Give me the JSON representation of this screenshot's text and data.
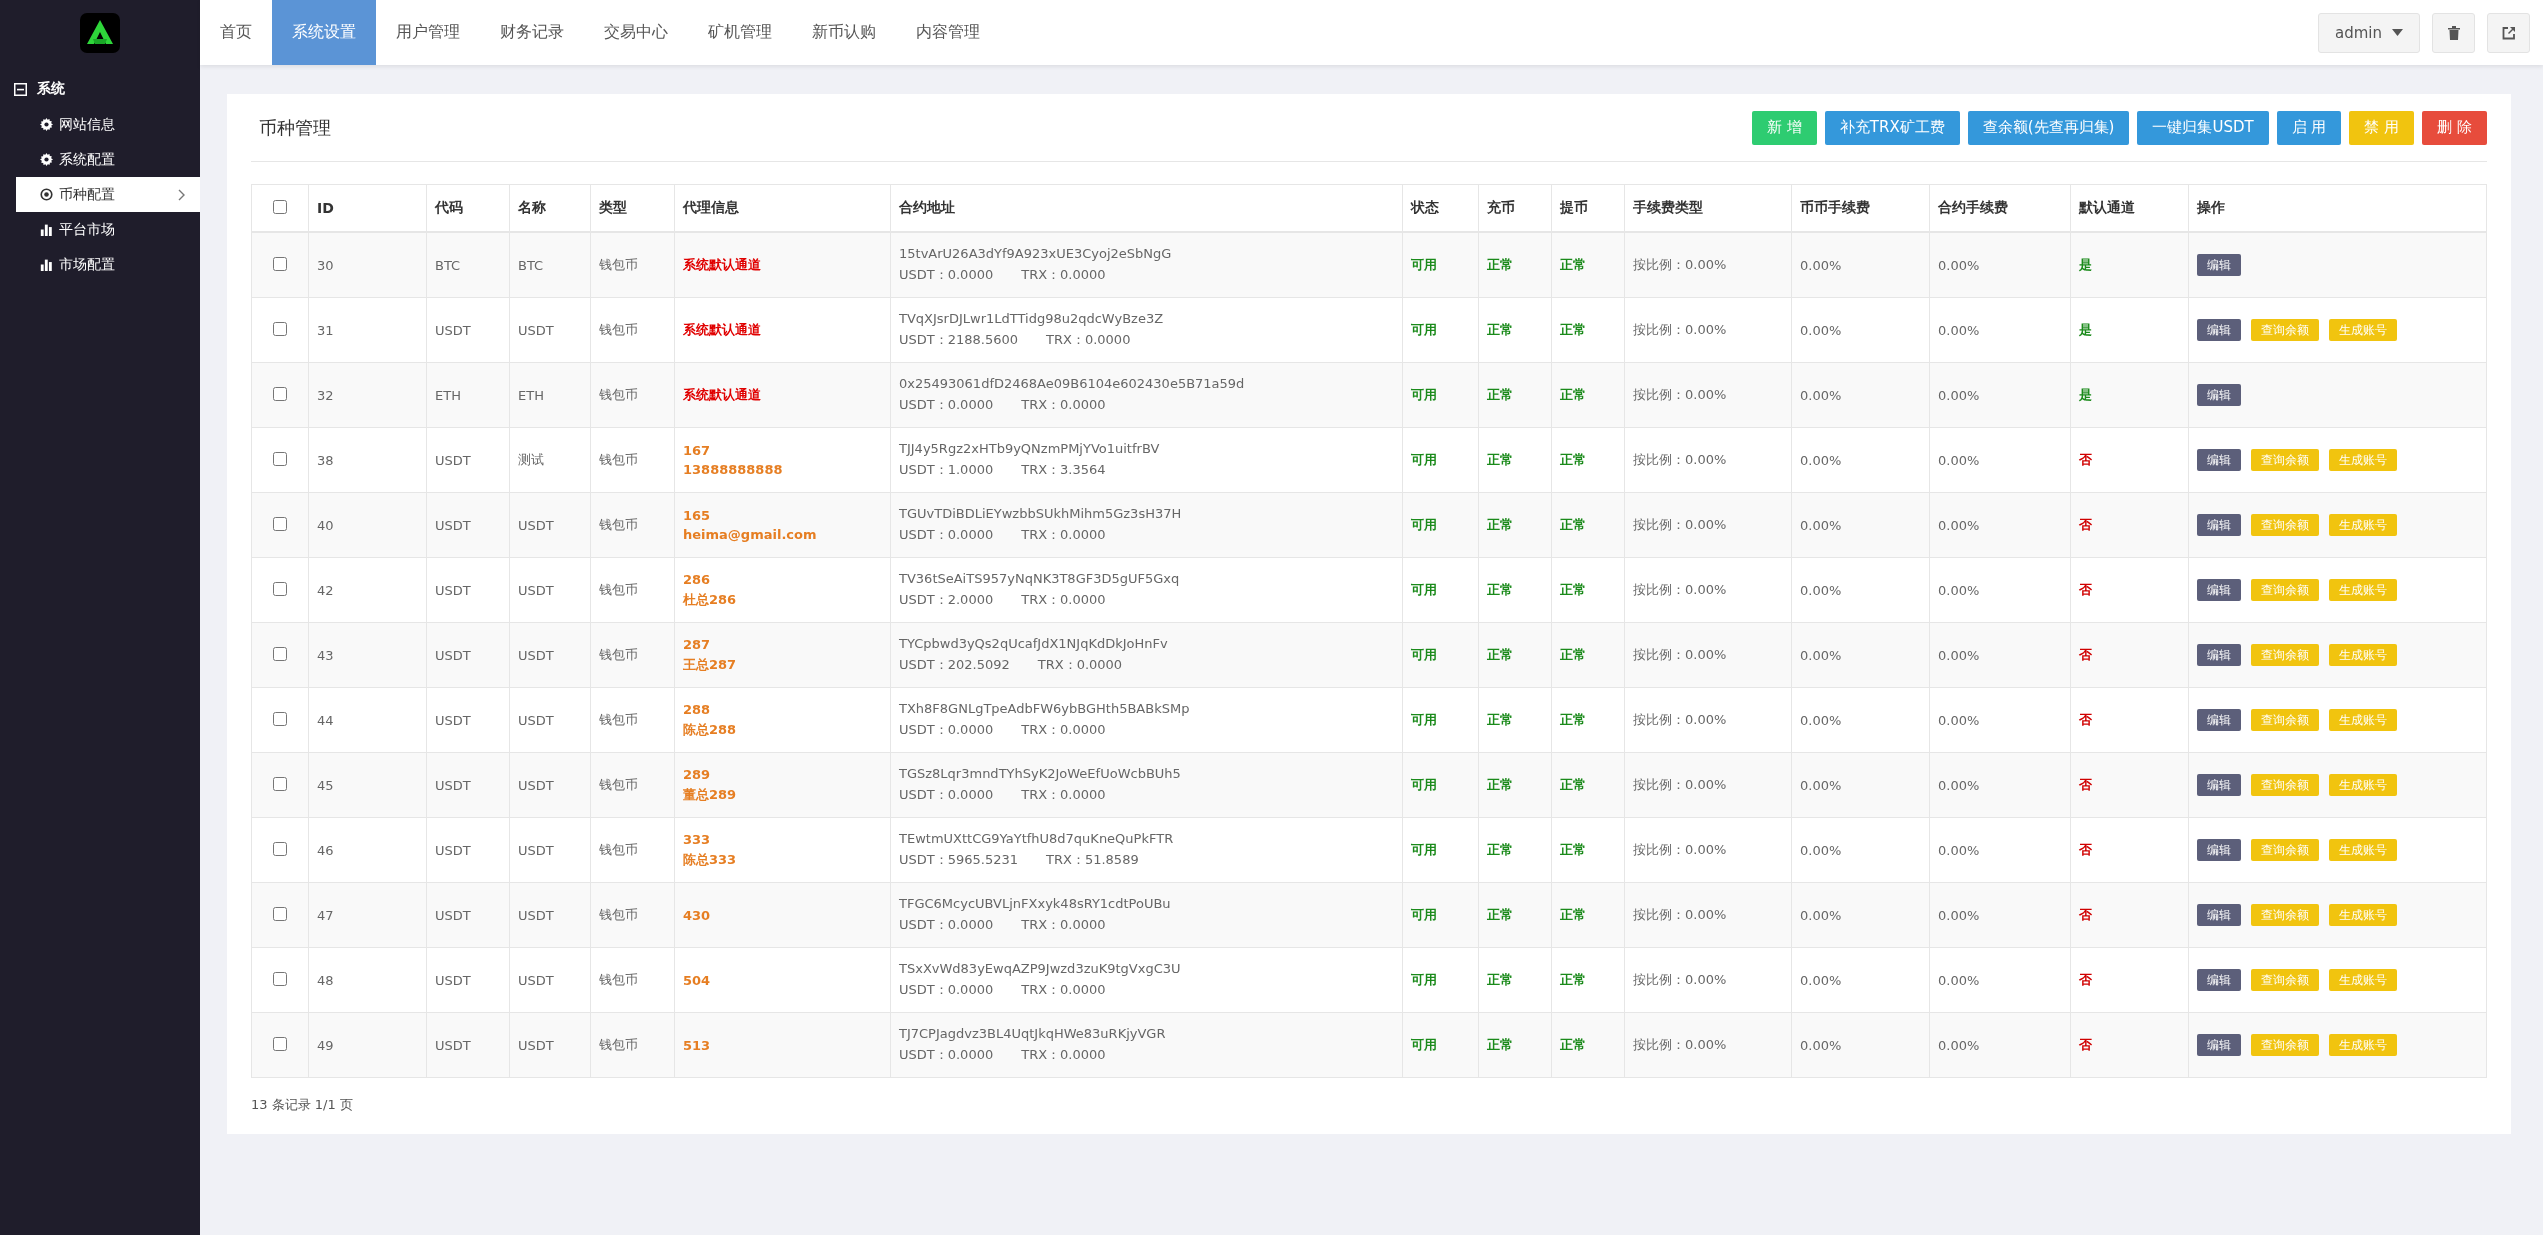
{
  "sidebar": {
    "group": {
      "label": "系统",
      "expanded": true
    },
    "items": [
      {
        "label": "网站信息",
        "selected": false
      },
      {
        "label": "系统配置",
        "selected": false
      },
      {
        "label": "币种配置",
        "selected": true
      },
      {
        "label": "平台市场",
        "selected": false
      },
      {
        "label": "市场配置",
        "selected": false
      }
    ]
  },
  "nav": {
    "tabs": [
      {
        "label": "首页",
        "selected": false
      },
      {
        "label": "系统设置",
        "selected": true
      },
      {
        "label": "用户管理",
        "selected": false
      },
      {
        "label": "财务记录",
        "selected": false
      },
      {
        "label": "交易中心",
        "selected": false
      },
      {
        "label": "矿机管理",
        "selected": false
      },
      {
        "label": "新币认购",
        "selected": false
      },
      {
        "label": "内容管理",
        "selected": false
      }
    ],
    "user": "admin"
  },
  "panel": {
    "title": "币种管理",
    "buttons": [
      {
        "label": "新 增",
        "kind": "success"
      },
      {
        "label": "补充TRX矿工费",
        "kind": "primary"
      },
      {
        "label": "查余额(先查再归集)",
        "kind": "primary"
      },
      {
        "label": "一键归集USDT",
        "kind": "primary"
      },
      {
        "label": "启 用",
        "kind": "primary"
      },
      {
        "label": "禁 用",
        "kind": "warning"
      },
      {
        "label": "删 除",
        "kind": "danger"
      }
    ],
    "table": {
      "all_checked": false,
      "columns": [
        "ID",
        "代码",
        "名称",
        "类型",
        "代理信息",
        "合约地址",
        "状态",
        "充币",
        "提币",
        "手续费类型",
        "币币手续费",
        "合约手续费",
        "默认通道",
        "操作"
      ],
      "rows": [
        {
          "selected": false,
          "id": "30",
          "code": "BTC",
          "name": "BTC",
          "type": "钱包币",
          "agent": {
            "kind": "default",
            "lines": [
              "系统默认通道"
            ]
          },
          "address": "15tvArU26A3dYf9A923xUE3Cyoj2eSbNgG",
          "usdt": "USDT：0.0000",
          "trx": "TRX：0.0000",
          "status": "可用",
          "deposit": "正常",
          "withdraw": "正常",
          "fee_type": "按比例：0.00%",
          "coin_fee": "0.00%",
          "contract_fee": "0.00%",
          "default": {
            "label": "是",
            "on": true
          },
          "actions": [
            {
              "label": "编辑",
              "kind": "edit"
            }
          ]
        },
        {
          "selected": false,
          "id": "31",
          "code": "USDT",
          "name": "USDT",
          "type": "钱包币",
          "agent": {
            "kind": "default",
            "lines": [
              "系统默认通道"
            ]
          },
          "address": "TVqXJsrDJLwr1LdTTidg98u2qdcWyBze3Z",
          "usdt": "USDT：2188.5600",
          "trx": "TRX：0.0000",
          "status": "可用",
          "deposit": "正常",
          "withdraw": "正常",
          "fee_type": "按比例：0.00%",
          "coin_fee": "0.00%",
          "contract_fee": "0.00%",
          "default": {
            "label": "是",
            "on": true
          },
          "actions": [
            {
              "label": "编辑",
              "kind": "edit"
            },
            {
              "label": "查询余额",
              "kind": "query"
            },
            {
              "label": "生成账号",
              "kind": "generate"
            }
          ]
        },
        {
          "selected": false,
          "id": "32",
          "code": "ETH",
          "name": "ETH",
          "type": "钱包币",
          "agent": {
            "kind": "default",
            "lines": [
              "系统默认通道"
            ]
          },
          "address": "0x25493061dfD2468Ae09B6104e602430e5B71a59d",
          "usdt": "USDT：0.0000",
          "trx": "TRX：0.0000",
          "status": "可用",
          "deposit": "正常",
          "withdraw": "正常",
          "fee_type": "按比例：0.00%",
          "coin_fee": "0.00%",
          "contract_fee": "0.00%",
          "default": {
            "label": "是",
            "on": true
          },
          "actions": [
            {
              "label": "编辑",
              "kind": "edit"
            }
          ]
        },
        {
          "selected": false,
          "id": "38",
          "code": "USDT",
          "name": "测试",
          "type": "钱包币",
          "agent": {
            "kind": "agent",
            "lines": [
              "167",
              "13888888888"
            ]
          },
          "address": "TJJ4y5Rgz2xHTb9yQNzmPMjYVo1uitfrBV",
          "usdt": "USDT：1.0000",
          "trx": "TRX：3.3564",
          "status": "可用",
          "deposit": "正常",
          "withdraw": "正常",
          "fee_type": "按比例：0.00%",
          "coin_fee": "0.00%",
          "contract_fee": "0.00%",
          "default": {
            "label": "否",
            "on": false
          },
          "actions": [
            {
              "label": "编辑",
              "kind": "edit"
            },
            {
              "label": "查询余额",
              "kind": "query"
            },
            {
              "label": "生成账号",
              "kind": "generate"
            }
          ]
        },
        {
          "selected": false,
          "id": "40",
          "code": "USDT",
          "name": "USDT",
          "type": "钱包币",
          "agent": {
            "kind": "agent",
            "lines": [
              "165",
              "heima@gmail.com"
            ]
          },
          "address": "TGUvTDiBDLiEYwzbbSUkhMihm5Gz3sH37H",
          "usdt": "USDT：0.0000",
          "trx": "TRX：0.0000",
          "status": "可用",
          "deposit": "正常",
          "withdraw": "正常",
          "fee_type": "按比例：0.00%",
          "coin_fee": "0.00%",
          "contract_fee": "0.00%",
          "default": {
            "label": "否",
            "on": false
          },
          "actions": [
            {
              "label": "编辑",
              "kind": "edit"
            },
            {
              "label": "查询余额",
              "kind": "query"
            },
            {
              "label": "生成账号",
              "kind": "generate"
            }
          ]
        },
        {
          "selected": false,
          "id": "42",
          "code": "USDT",
          "name": "USDT",
          "type": "钱包币",
          "agent": {
            "kind": "agent",
            "lines": [
              "286",
              "杜总286"
            ]
          },
          "address": "TV36tSeAiTS957yNqNK3T8GF3D5gUF5Gxq",
          "usdt": "USDT：2.0000",
          "trx": "TRX：0.0000",
          "status": "可用",
          "deposit": "正常",
          "withdraw": "正常",
          "fee_type": "按比例：0.00%",
          "coin_fee": "0.00%",
          "contract_fee": "0.00%",
          "default": {
            "label": "否",
            "on": false
          },
          "actions": [
            {
              "label": "编辑",
              "kind": "edit"
            },
            {
              "label": "查询余额",
              "kind": "query"
            },
            {
              "label": "生成账号",
              "kind": "generate"
            }
          ]
        },
        {
          "selected": false,
          "id": "43",
          "code": "USDT",
          "name": "USDT",
          "type": "钱包币",
          "agent": {
            "kind": "agent",
            "lines": [
              "287",
              "王总287"
            ]
          },
          "address": "TYCpbwd3yQs2qUcafJdX1NJqKdDkJoHnFv",
          "usdt": "USDT：202.5092",
          "trx": "TRX：0.0000",
          "status": "可用",
          "deposit": "正常",
          "withdraw": "正常",
          "fee_type": "按比例：0.00%",
          "coin_fee": "0.00%",
          "contract_fee": "0.00%",
          "default": {
            "label": "否",
            "on": false
          },
          "actions": [
            {
              "label": "编辑",
              "kind": "edit"
            },
            {
              "label": "查询余额",
              "kind": "query"
            },
            {
              "label": "生成账号",
              "kind": "generate"
            }
          ]
        },
        {
          "selected": false,
          "id": "44",
          "code": "USDT",
          "name": "USDT",
          "type": "钱包币",
          "agent": {
            "kind": "agent",
            "lines": [
              "288",
              "陈总288"
            ]
          },
          "address": "TXh8F8GNLgTpeAdbFW6ybBGHth5BABkSMp",
          "usdt": "USDT：0.0000",
          "trx": "TRX：0.0000",
          "status": "可用",
          "deposit": "正常",
          "withdraw": "正常",
          "fee_type": "按比例：0.00%",
          "coin_fee": "0.00%",
          "contract_fee": "0.00%",
          "default": {
            "label": "否",
            "on": false
          },
          "actions": [
            {
              "label": "编辑",
              "kind": "edit"
            },
            {
              "label": "查询余额",
              "kind": "query"
            },
            {
              "label": "生成账号",
              "kind": "generate"
            }
          ]
        },
        {
          "selected": false,
          "id": "45",
          "code": "USDT",
          "name": "USDT",
          "type": "钱包币",
          "agent": {
            "kind": "agent",
            "lines": [
              "289",
              "董总289"
            ]
          },
          "address": "TGSz8Lqr3mndTYhSyK2JoWeEfUoWcbBUh5",
          "usdt": "USDT：0.0000",
          "trx": "TRX：0.0000",
          "status": "可用",
          "deposit": "正常",
          "withdraw": "正常",
          "fee_type": "按比例：0.00%",
          "coin_fee": "0.00%",
          "contract_fee": "0.00%",
          "default": {
            "label": "否",
            "on": false
          },
          "actions": [
            {
              "label": "编辑",
              "kind": "edit"
            },
            {
              "label": "查询余额",
              "kind": "query"
            },
            {
              "label": "生成账号",
              "kind": "generate"
            }
          ]
        },
        {
          "selected": false,
          "id": "46",
          "code": "USDT",
          "name": "USDT",
          "type": "钱包币",
          "agent": {
            "kind": "agent",
            "lines": [
              "333",
              "陈总333"
            ]
          },
          "address": "TEwtmUXttCG9YaYtfhU8d7quKneQuPkFTR",
          "usdt": "USDT：5965.5231",
          "trx": "TRX：51.8589",
          "status": "可用",
          "deposit": "正常",
          "withdraw": "正常",
          "fee_type": "按比例：0.00%",
          "coin_fee": "0.00%",
          "contract_fee": "0.00%",
          "default": {
            "label": "否",
            "on": false
          },
          "actions": [
            {
              "label": "编辑",
              "kind": "edit"
            },
            {
              "label": "查询余额",
              "kind": "query"
            },
            {
              "label": "生成账号",
              "kind": "generate"
            }
          ]
        },
        {
          "selected": false,
          "id": "47",
          "code": "USDT",
          "name": "USDT",
          "type": "钱包币",
          "agent": {
            "kind": "agent",
            "lines": [
              "430"
            ]
          },
          "address": "TFGC6McycUBVLjnFXxyk48sRY1cdtPoUBu",
          "usdt": "USDT：0.0000",
          "trx": "TRX：0.0000",
          "status": "可用",
          "deposit": "正常",
          "withdraw": "正常",
          "fee_type": "按比例：0.00%",
          "coin_fee": "0.00%",
          "contract_fee": "0.00%",
          "default": {
            "label": "否",
            "on": false
          },
          "actions": [
            {
              "label": "编辑",
              "kind": "edit"
            },
            {
              "label": "查询余额",
              "kind": "query"
            },
            {
              "label": "生成账号",
              "kind": "generate"
            }
          ]
        },
        {
          "selected": false,
          "id": "48",
          "code": "USDT",
          "name": "USDT",
          "type": "钱包币",
          "agent": {
            "kind": "agent",
            "lines": [
              "504"
            ]
          },
          "address": "TSxXvWd83yEwqAZP9Jwzd3zuK9tgVxgC3U",
          "usdt": "USDT：0.0000",
          "trx": "TRX：0.0000",
          "status": "可用",
          "deposit": "正常",
          "withdraw": "正常",
          "fee_type": "按比例：0.00%",
          "coin_fee": "0.00%",
          "contract_fee": "0.00%",
          "default": {
            "label": "否",
            "on": false
          },
          "actions": [
            {
              "label": "编辑",
              "kind": "edit"
            },
            {
              "label": "查询余额",
              "kind": "query"
            },
            {
              "label": "生成账号",
              "kind": "generate"
            }
          ]
        },
        {
          "selected": false,
          "id": "49",
          "code": "USDT",
          "name": "USDT",
          "type": "钱包币",
          "agent": {
            "kind": "agent",
            "lines": [
              "513"
            ]
          },
          "address": "TJ7CPJagdvz3BL4UqtJkqHWe83uRKjyVGR",
          "usdt": "USDT：0.0000",
          "trx": "TRX：0.0000",
          "status": "可用",
          "deposit": "正常",
          "withdraw": "正常",
          "fee_type": "按比例：0.00%",
          "coin_fee": "0.00%",
          "contract_fee": "0.00%",
          "default": {
            "label": "否",
            "on": false
          },
          "actions": [
            {
              "label": "编辑",
              "kind": "edit"
            },
            {
              "label": "查询余额",
              "kind": "query"
            },
            {
              "label": "生成账号",
              "kind": "generate"
            }
          ]
        }
      ]
    },
    "footer": "13 条记录 1/1 页"
  }
}
